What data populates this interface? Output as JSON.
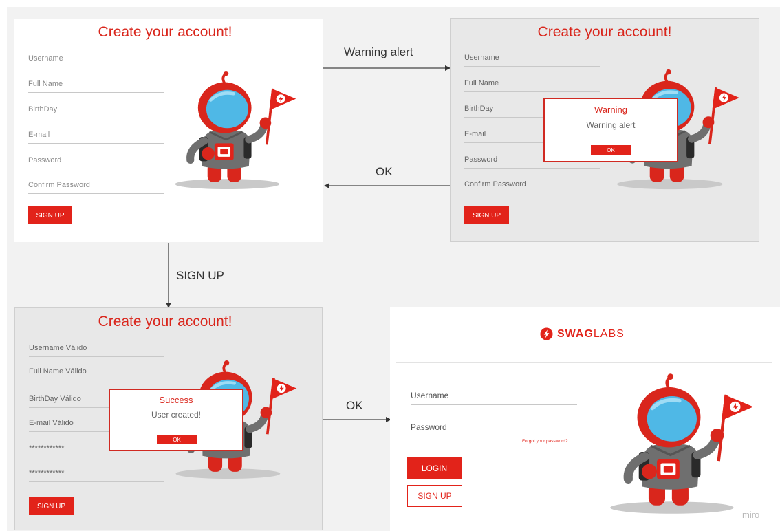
{
  "signup_form": {
    "title": "Create your account!",
    "fields": [
      "Username",
      "Full Name",
      "BirthDay",
      "E-mail",
      "Password",
      "Confirm Password"
    ],
    "button": "SIGN UP"
  },
  "filled_form": {
    "fields": [
      "Username Válido",
      "Full Name Válido",
      "BirthDay Válido",
      "E-mail Válido",
      "************",
      "************"
    ]
  },
  "warning_modal": {
    "title": "Warning",
    "message": "Warning alert",
    "button": "OK"
  },
  "success_modal": {
    "title": "Success",
    "message": "User created!",
    "button": "OK"
  },
  "connectors": {
    "warning": "Warning alert",
    "ok_back": "OK",
    "signup": "SIGN UP",
    "ok_login": "OK"
  },
  "login": {
    "brand_prefix": "SWAG",
    "brand_suffix": "LABS",
    "username_label": "Username",
    "password_label": "Password",
    "forgot": "Forgot your password?",
    "login_button": "LOGIN",
    "signup_button": "SIGN UP"
  },
  "watermark": "miro",
  "colors": {
    "accent": "#e2231a",
    "board": "#f2f2f2",
    "mascot_visor": "#4fb8e6"
  },
  "icons": {
    "mascot": "robot-mascot-icon",
    "logo": "swaglabs-bolt-icon"
  }
}
